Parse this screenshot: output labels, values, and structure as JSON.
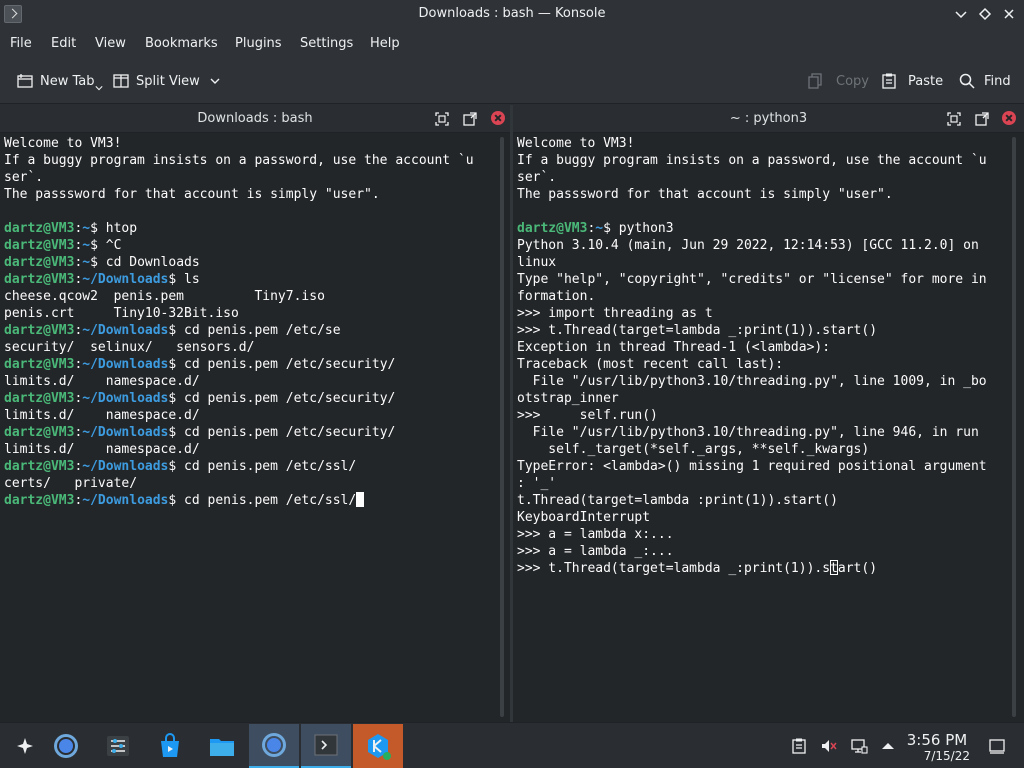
{
  "window": {
    "title": "Downloads : bash — Konsole"
  },
  "menu": [
    "File",
    "Edit",
    "View",
    "Bookmarks",
    "Plugins",
    "Settings",
    "Help"
  ],
  "toolbar": {
    "new_tab": "New Tab",
    "split_view": "Split View",
    "copy": "Copy",
    "paste": "Paste",
    "find": "Find"
  },
  "left_pane": {
    "title": "Downloads : bash",
    "lines": [
      [
        {
          "t": "Welcome to VM3!"
        }
      ],
      [
        {
          "t": "If a buggy program insists on a password, use the account `u"
        }
      ],
      [
        {
          "t": "ser`."
        }
      ],
      [
        {
          "t": "The passsword for that account is simply \"user\"."
        }
      ],
      [],
      [
        {
          "t": "dartz@VM3",
          "c": "u"
        },
        {
          "t": ":"
        },
        {
          "t": "~",
          "c": "p"
        },
        {
          "t": "$ htop"
        }
      ],
      [
        {
          "t": "dartz@VM3",
          "c": "u"
        },
        {
          "t": ":"
        },
        {
          "t": "~",
          "c": "p"
        },
        {
          "t": "$ ^C"
        }
      ],
      [
        {
          "t": "dartz@VM3",
          "c": "u"
        },
        {
          "t": ":"
        },
        {
          "t": "~",
          "c": "p"
        },
        {
          "t": "$ cd Downloads"
        }
      ],
      [
        {
          "t": "dartz@VM3",
          "c": "u"
        },
        {
          "t": ":"
        },
        {
          "t": "~/Downloads",
          "c": "p"
        },
        {
          "t": "$ ls"
        }
      ],
      [
        {
          "t": "cheese.qcow2  penis.pem         Tiny7.iso"
        }
      ],
      [
        {
          "t": "penis.crt     Tiny10-32Bit.iso"
        }
      ],
      [
        {
          "t": "dartz@VM3",
          "c": "u"
        },
        {
          "t": ":"
        },
        {
          "t": "~/Downloads",
          "c": "p"
        },
        {
          "t": "$ cd penis.pem /etc/se"
        }
      ],
      [
        {
          "t": "security/  selinux/   sensors.d/"
        }
      ],
      [
        {
          "t": "dartz@VM3",
          "c": "u"
        },
        {
          "t": ":"
        },
        {
          "t": "~/Downloads",
          "c": "p"
        },
        {
          "t": "$ cd penis.pem /etc/security/"
        }
      ],
      [
        {
          "t": "limits.d/    namespace.d/"
        }
      ],
      [
        {
          "t": "dartz@VM3",
          "c": "u"
        },
        {
          "t": ":"
        },
        {
          "t": "~/Downloads",
          "c": "p"
        },
        {
          "t": "$ cd penis.pem /etc/security/"
        }
      ],
      [
        {
          "t": "limits.d/    namespace.d/"
        }
      ],
      [
        {
          "t": "dartz@VM3",
          "c": "u"
        },
        {
          "t": ":"
        },
        {
          "t": "~/Downloads",
          "c": "p"
        },
        {
          "t": "$ cd penis.pem /etc/security/"
        }
      ],
      [
        {
          "t": "limits.d/    namespace.d/"
        }
      ],
      [
        {
          "t": "dartz@VM3",
          "c": "u"
        },
        {
          "t": ":"
        },
        {
          "t": "~/Downloads",
          "c": "p"
        },
        {
          "t": "$ cd penis.pem /etc/ssl/"
        }
      ],
      [
        {
          "t": "certs/   private/"
        }
      ],
      [
        {
          "t": "dartz@VM3",
          "c": "u"
        },
        {
          "t": ":"
        },
        {
          "t": "~/Downloads",
          "c": "p"
        },
        {
          "t": "$ cd penis.pem /etc/ssl/"
        },
        {
          "cursor": "block"
        }
      ]
    ]
  },
  "right_pane": {
    "title": "~ : python3",
    "lines": [
      [
        {
          "t": "Welcome to VM3!"
        }
      ],
      [
        {
          "t": "If a buggy program insists on a password, use the account `u"
        }
      ],
      [
        {
          "t": "ser`."
        }
      ],
      [
        {
          "t": "The passsword for that account is simply \"user\"."
        }
      ],
      [],
      [
        {
          "t": "dartz@VM3",
          "c": "u"
        },
        {
          "t": ":"
        },
        {
          "t": "~",
          "c": "p"
        },
        {
          "t": "$ python3"
        }
      ],
      [
        {
          "t": "Python 3.10.4 (main, Jun 29 2022, 12:14:53) [GCC 11.2.0] on"
        }
      ],
      [
        {
          "t": "linux"
        }
      ],
      [
        {
          "t": "Type \"help\", \"copyright\", \"credits\" or \"license\" for more in"
        }
      ],
      [
        {
          "t": "formation."
        }
      ],
      [
        {
          "t": ">>> import threading as t"
        }
      ],
      [
        {
          "t": ">>> t.Thread(target=lambda _:print(1)).start()"
        }
      ],
      [
        {
          "t": "Exception in thread Thread-1 (<lambda>):"
        }
      ],
      [
        {
          "t": "Traceback (most recent call last):"
        }
      ],
      [
        {
          "t": "  File \"/usr/lib/python3.10/threading.py\", line 1009, in _bo"
        }
      ],
      [
        {
          "t": "otstrap_inner"
        }
      ],
      [
        {
          "t": ">>>     self.run()"
        }
      ],
      [
        {
          "t": "  File \"/usr/lib/python3.10/threading.py\", line 946, in run"
        }
      ],
      [
        {
          "t": "    self._target(*self._args, **self._kwargs)"
        }
      ],
      [
        {
          "t": "TypeError: <lambda>() missing 1 required positional argument"
        }
      ],
      [
        {
          "t": ": '_'"
        }
      ],
      [
        {
          "t": "t.Thread(target=lambda :print(1)).start()"
        }
      ],
      [
        {
          "t": "KeyboardInterrupt"
        }
      ],
      [
        {
          "t": ">>> a = lambda x:..."
        }
      ],
      [
        {
          "t": ">>> a = lambda _:..."
        }
      ],
      [
        {
          "t": ">>> t.Thread(target=lambda _:print(1)).s"
        },
        {
          "cursor": "hollow"
        },
        {
          "t": "tart()"
        }
      ]
    ]
  },
  "taskbar": {
    "tasks": [
      {
        "name": "application-launcher-icon",
        "active": false
      },
      {
        "name": "chromium-icon",
        "active": false
      },
      {
        "name": "system-settings-icon",
        "active": false
      },
      {
        "name": "discover-store-icon",
        "active": false
      },
      {
        "name": "dolphin-files-icon",
        "active": false
      },
      {
        "name": "chromium-window-icon",
        "active": true
      },
      {
        "name": "konsole-icon",
        "active": true
      },
      {
        "name": "kde-tweaks-icon",
        "active": false
      }
    ],
    "time": "3:56 PM",
    "date": "7/15/22"
  },
  "colors": {
    "prompt_user": "#4ab878",
    "prompt_path": "#3d9ce0",
    "accent": "#3daee9",
    "close": "#da4453"
  }
}
